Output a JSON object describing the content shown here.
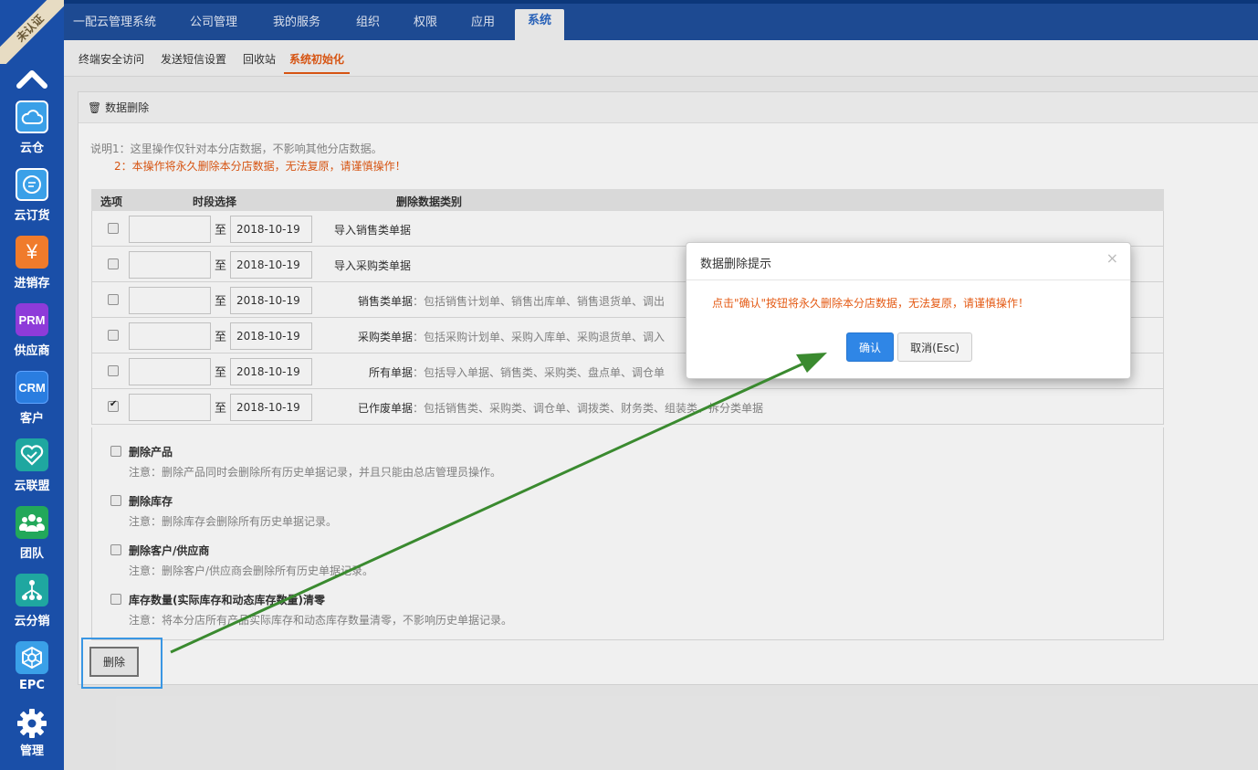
{
  "colors": {
    "rail": "#1a4fa8",
    "topnav": "#1f4f9c",
    "accent_orange": "#e45a14",
    "primary_blue": "#2f86e6",
    "arrow_green": "#3a8a2f"
  },
  "rail": {
    "badge": "未认证",
    "apps": [
      {
        "label": "云仓",
        "icon": "cloud-icon",
        "color": "#3aa0e8"
      },
      {
        "label": "云订货",
        "icon": "chat-icon",
        "color": "#3aa0e8"
      },
      {
        "label": "进销存",
        "icon": "yen-icon",
        "glyph": "¥",
        "color": "#f07b2b"
      },
      {
        "label": "供应商",
        "icon": "prm-icon",
        "glyph": "PRM",
        "color": "#8e3bd9"
      },
      {
        "label": "客户",
        "icon": "crm-icon",
        "glyph": "CRM",
        "color": "#2a7de0"
      },
      {
        "label": "云联盟",
        "icon": "heart-handshake-icon",
        "color": "#1fa7a0"
      },
      {
        "label": "团队",
        "icon": "team-icon",
        "color": "#22a85a"
      },
      {
        "label": "云分销",
        "icon": "network-icon",
        "color": "#1fa7a0"
      },
      {
        "label": "EPC",
        "icon": "epc-icon",
        "color": "#3aa0e8"
      },
      {
        "label": "管理",
        "icon": "gear-icon",
        "color": "none"
      }
    ]
  },
  "topnav": {
    "brand": "一配云管理系统",
    "items": [
      "公司管理",
      "我的服务",
      "组织",
      "权限",
      "应用",
      "系统"
    ],
    "active": "系统"
  },
  "subnav": {
    "items": [
      "终端安全访问",
      "发送短信设置",
      "回收站",
      "系统初始化"
    ],
    "active": "系统初始化"
  },
  "panel": {
    "title": "数据删除",
    "note1": "说明1：这里操作仅针对本分店数据，不影响其他分店数据。",
    "note2": "2：本操作将永久删除本分店数据，无法复原，请谨慎操作！",
    "table": {
      "headers": [
        "选项",
        "时段选择",
        "删除数据类别"
      ],
      "to_label": "至",
      "rows": [
        {
          "checked": false,
          "start": "",
          "end": "2018-10-19",
          "name": "导入销售类单据",
          "desc": ""
        },
        {
          "checked": false,
          "start": "",
          "end": "2018-10-19",
          "name": "导入采购类单据",
          "desc": ""
        },
        {
          "checked": false,
          "start": "",
          "end": "2018-10-19",
          "name": "销售类单据",
          "desc": "：包括销售计划单、销售出库单、销售退货单、调出"
        },
        {
          "checked": false,
          "start": "",
          "end": "2018-10-19",
          "name": "采购类单据",
          "desc": "：包括采购计划单、采购入库单、采购退货单、调入"
        },
        {
          "checked": false,
          "start": "",
          "end": "2018-10-19",
          "name": "所有单据",
          "desc": "：包括导入单据、销售类、采购类、盘点单、调仓单"
        },
        {
          "checked": true,
          "start": "",
          "end": "2018-10-19",
          "name": "已作废单据",
          "desc": "：包括销售类、采购类、调仓单、调拨类、财务类、组装类、拆分类单据"
        }
      ]
    },
    "options": [
      {
        "title": "删除产品",
        "note": "注意：删除产品同时会删除所有历史单据记录，并且只能由总店管理员操作。"
      },
      {
        "title": "删除库存",
        "note": "注意：删除库存会删除所有历史单据记录。"
      },
      {
        "title": "删除客户/供应商",
        "note": "注意：删除客户/供应商会删除所有历史单据记录。"
      },
      {
        "title": "库存数量(实际库存和动态库存数量)清零",
        "note": "注意：将本分店所有产品实际库存和动态库存数量清零，不影响历史单据记录。"
      }
    ],
    "delete_label": "删除"
  },
  "modal": {
    "title": "数据删除提示",
    "close": "×",
    "message": "点击\"确认\"按钮将永久删除本分店数据，无法复原，请谨慎操作！",
    "ok_label": "确认",
    "cancel_label": "取消(Esc)"
  }
}
